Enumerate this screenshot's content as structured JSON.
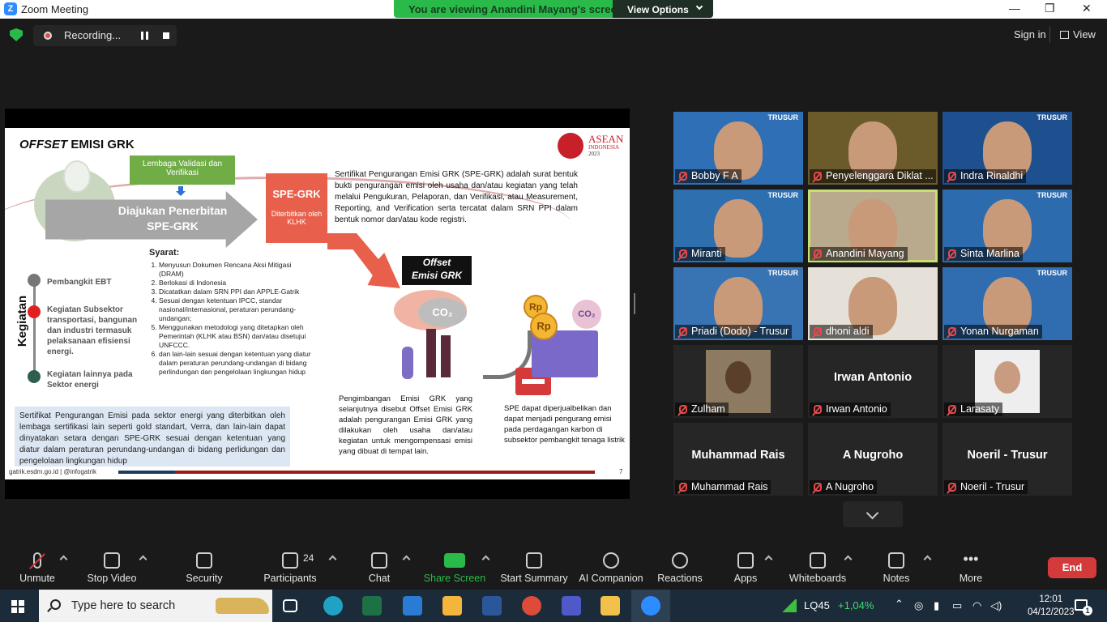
{
  "window": {
    "title": "Zoom Meeting",
    "logo": "Z",
    "minimize": "—",
    "restore": "❐",
    "close": "✕"
  },
  "banner": {
    "message": "You are viewing Anandini Mayang's screen",
    "view_options": "View Options"
  },
  "topbar": {
    "recording": "Recording...",
    "sign_in": "Sign in",
    "view": "View"
  },
  "slide": {
    "title_italic": "OFFSET",
    "title_rest": " EMISI GRK",
    "asean_line1": "ASEAN",
    "asean_line2": "INDONESIA",
    "asean_year": "2023",
    "green_box": "Lembaga Validasi dan Verifikasi",
    "grey_arrow": "Diajukan Penerbitan SPE-GRK",
    "spe_title": "SPE-GRK",
    "spe_sub": "Diterbitkan oleh KLHK",
    "definition": "Sertifikat Pengurangan Emisi GRK (SPE-GRK) adalah surat bentuk bukti pengurangan emisi oleh usaha dan/atau kegiatan yang telah melalui Pengukuran, Pelaporan, dan Verifikasi, atau Measurement, Reporting, and Verification serta tercatat dalam SRN PPI dalam bentuk nomor dan/atau kode registri.",
    "syarat_title": "Syarat:",
    "syarat": [
      "Menyusun Dokumen Rencana Aksi Mitigasi (DRAM)",
      "Berlokasi di Indonesia",
      "Dicatatkan dalam SRN PPI dan APPLE-Gatrik",
      "Sesuai dengan ketentuan IPCC, standar nasional/internasional, peraturan perundang-undangan;",
      "Menggunakan metodologi yang ditetapkan oleh Pemerintah (KLHK atau BSN) dan/atau disetujui UNFCCC.",
      "dan lain-lain sesuai dengan ketentuan yang diatur dalam peraturan perundang-undangan di bidang perlindungan dan pengelolaan lingkungan hidup"
    ],
    "kegiatan_label": "Kegiatan",
    "kegiatan": [
      "Pembangkit EBT",
      "Kegiatan Subsektor transportasi, bangunan dan industri termasuk pelaksanaan efisiensi energi.",
      "Kegiatan lainnya pada Sektor energi"
    ],
    "offset_tag_1": "Offset",
    "offset_tag_2": "Emisi GRK",
    "co2": "CO₂",
    "coin_label": "Rp",
    "pengimbangan": "Pengimbangan Emisi GRK yang selanjutnya disebut Offset Emisi GRK adalah pengurangan Emisi GRK yang dilakukan oleh usaha dan/atau kegiatan untuk mengompensasi emisi yang dibuat di tempat lain.",
    "spe_trade": "SPE dapat diperjualbelikan dan dapat menjadi pengurang emisi pada perdagangan karbon di subsektor pembangkit tenaga listrik",
    "bluebox": "Sertifikat Pengurangan Emisi pada sektor energi yang diterbitkan oleh lembaga sertifikasi lain seperti gold standart, Verra, dan lain-lain dapat dinyatakan setara dengan SPE-GRK sesuai dengan ketentuan yang diatur dalam peraturan perundang-undangan di bidang perlidungan dan pengelolaan lingkungan hidup",
    "footer": "gatrik.esdm.go.id | @infogatrik",
    "page": "7"
  },
  "participants": [
    {
      "name": "Bobby F A",
      "kind": "video",
      "bg": "#2f6fb5"
    },
    {
      "name": "Penyelenggara Diklat ...",
      "kind": "video",
      "bg": "#6b5a2a"
    },
    {
      "name": "Indra Rinaldhi",
      "kind": "video",
      "bg": "#1e4f8f"
    },
    {
      "name": "Miranti",
      "kind": "video",
      "bg": "#2e6fb0"
    },
    {
      "name": "Anandini Mayang",
      "kind": "video",
      "bg": "#b9a98d"
    },
    {
      "name": "Sinta Marlina",
      "kind": "video",
      "bg": "#2c6cae"
    },
    {
      "name": "Priadi (Dodo) - Trusur",
      "kind": "video",
      "bg": "#3874b3"
    },
    {
      "name": "dhoni aldi",
      "kind": "video",
      "bg": "#e5e1d8"
    },
    {
      "name": "Yonan Nurgaman",
      "kind": "video",
      "bg": "#2f6db0"
    },
    {
      "name": "Zulham",
      "kind": "photo",
      "bg": "#262626"
    },
    {
      "name": "Irwan Antonio",
      "kind": "name",
      "bg": "#262626"
    },
    {
      "name": "Larasaty",
      "kind": "photo",
      "bg": "#262626"
    },
    {
      "name": "Muhammad Rais",
      "kind": "name",
      "bg": "#262626"
    },
    {
      "name": "A Nugroho",
      "kind": "name",
      "bg": "#262626"
    },
    {
      "name": "Noeril - Trusur",
      "kind": "name",
      "bg": "#262626"
    }
  ],
  "trusur_label": "TRUSUR",
  "toolbar": [
    {
      "label": "Unmute",
      "icon": "mic-muted-icon"
    },
    {
      "label": "Stop Video",
      "icon": "video-camera-icon"
    },
    {
      "label": "Security",
      "icon": "shield-icon"
    },
    {
      "label": "Participants",
      "icon": "people-icon",
      "count": "24"
    },
    {
      "label": "Chat",
      "icon": "chat-bubble-icon"
    },
    {
      "label": "Share Screen",
      "icon": "share-screen-icon"
    },
    {
      "label": "Start Summary",
      "icon": "summary-icon"
    },
    {
      "label": "AI Companion",
      "icon": "sparkle-icon"
    },
    {
      "label": "Reactions",
      "icon": "smile-icon"
    },
    {
      "label": "Apps",
      "icon": "apps-icon"
    },
    {
      "label": "Whiteboards",
      "icon": "whiteboard-icon"
    },
    {
      "label": "Notes",
      "icon": "notes-icon"
    },
    {
      "label": "More",
      "icon": "more-dots-icon"
    }
  ],
  "end_label": "End",
  "taskbar": {
    "search_placeholder": "Type here to search",
    "stock": "LQ45",
    "stock_change": "+1,04%",
    "time": "12:01",
    "date": "04/12/2023",
    "notifications": "1"
  },
  "colors": {
    "accent_green": "#2aba4a",
    "end_red": "#d43a3a",
    "active_speaker": "#c9e070",
    "share_green": "#2aba4a"
  }
}
